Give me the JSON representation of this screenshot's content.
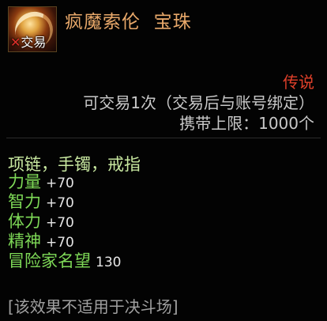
{
  "item": {
    "name": "疯魔索伦",
    "type": "宝珠",
    "icon_name": "orb-icon",
    "tradable_tag": "交易",
    "rarity": "传说",
    "trade_info": "可交易1次（交易后与账号绑定）",
    "carry_limit": "携带上限：1000个",
    "slots": "项链，手镯，戒指",
    "stats": [
      {
        "name": "力量",
        "value": "+70"
      },
      {
        "name": "智力",
        "value": "+70"
      },
      {
        "name": "体力",
        "value": "+70"
      },
      {
        "name": "精神",
        "value": "+70"
      },
      {
        "name": "冒险家名望",
        "value": "130"
      }
    ],
    "note": "[该效果不适用于决斗场]"
  },
  "colors": {
    "title": "#e8a86a",
    "rarity": "#e0402a",
    "stat_name": "#7ed957",
    "slot": "#c8e8a0"
  }
}
